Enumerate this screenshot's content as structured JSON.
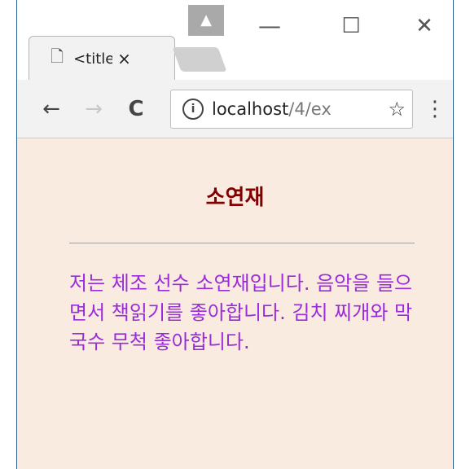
{
  "browser": {
    "tab": {
      "title": "<title>",
      "close": "×"
    },
    "profile_icon": "person-icon",
    "window_controls": {
      "minimize": "—",
      "maximize": "☐",
      "close": "✕"
    },
    "nav": {
      "back": "←",
      "forward": "→",
      "reload": "C"
    },
    "address": {
      "host": "localhost",
      "path": "/4/ex",
      "info": "i"
    },
    "star": "☆",
    "menu": "⋮"
  },
  "page": {
    "heading": "소연재",
    "paragraph": "저는 체조 선수 소연재입니다. 음악을 들으면서 책읽기를 좋아합니다. 김치 찌개와 막국수 무척 좋아합니다.",
    "colors": {
      "background": "#faebe0",
      "heading": "#800000",
      "paragraph": "#9a2bdb"
    }
  }
}
